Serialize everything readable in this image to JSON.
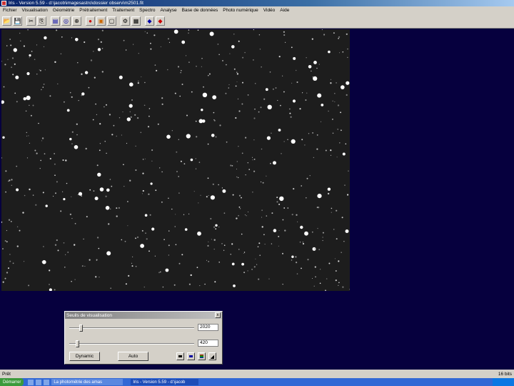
{
  "window": {
    "title": "Iris - Version 5.59 - d:\\jacob\\imagesastro\\dossier observ\\m2501.fit"
  },
  "menu": [
    "Fichier",
    "Visualisation",
    "Géométrie",
    "Prétraitement",
    "Traitement",
    "Spectro",
    "Analyse",
    "Base de données",
    "Photo numérique",
    "Vidéo",
    "Aide"
  ],
  "toolbar_icons": [
    "open-icon",
    "save-icon",
    "cut-icon",
    "copy-icon",
    "stack-icon",
    "photometry-icon",
    "zoom-icon",
    "color-icon",
    "image-a-icon",
    "image-b-icon",
    "image-c-icon",
    "settings-icon",
    "grid-icon",
    "histogram-icon",
    "palette-icon"
  ],
  "dialog": {
    "title": "Seuils de visualisation",
    "close_label": "x",
    "high_value": "2020",
    "low_value": "420",
    "high_level": 0.08,
    "low_level": 0.05,
    "auto_button": "Dynamic",
    "help_button": "Auto",
    "color_buttons": [
      "#000000",
      "#0000a0",
      "#c00000",
      "#000000"
    ]
  },
  "status": {
    "left": "Prêt",
    "right": "16 bits"
  },
  "taskbar": {
    "start_label": "Démarrer",
    "tasks": [
      "La photométrie des amas",
      "Iris - Version 5.59 - d:\\jacob"
    ]
  }
}
